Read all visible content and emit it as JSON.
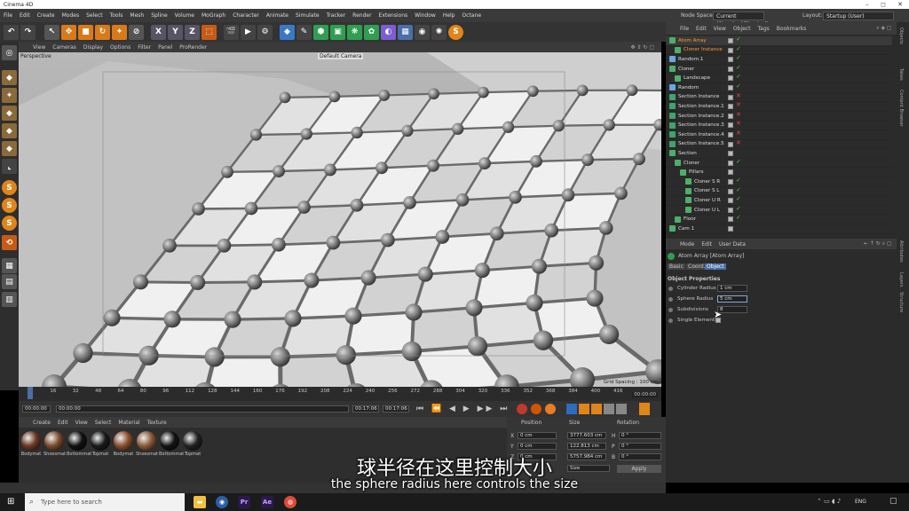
{
  "window": {
    "title": "Cinema 4D",
    "min": "–",
    "max": "◻",
    "close": "✕"
  },
  "menu": {
    "items": [
      "File",
      "Edit",
      "Create",
      "Modes",
      "Select",
      "Tools",
      "Mesh",
      "Spline",
      "Volume",
      "MoGraph",
      "Character",
      "Animate",
      "Simulate",
      "Tracker",
      "Render",
      "Extensions",
      "Window",
      "Help",
      "Octane"
    ],
    "node_space_label": "Node Space:",
    "node_space_value": "Current (Standard/Physical)",
    "layout_label": "Layout:",
    "layout_value": "Startup (User)"
  },
  "toolbar": {
    "x": "X",
    "y": "Y",
    "z": "Z"
  },
  "viewport": {
    "menu": [
      "View",
      "Cameras",
      "Display",
      "Options",
      "Filter",
      "Panel",
      "ProRender"
    ],
    "label": "Perspective",
    "camera": "Default Camera",
    "grid_spacing": "Grid Spacing : 100 cm"
  },
  "timeline": {
    "ticks": [
      "0",
      "16",
      "32",
      "48",
      "64",
      "80",
      "96",
      "112",
      "128",
      "144",
      "160",
      "176",
      "192",
      "208",
      "224",
      "240",
      "256",
      "272",
      "288",
      "304",
      "320",
      "336",
      "352",
      "368",
      "384",
      "400",
      "416"
    ],
    "current_frame": "00:00:00"
  },
  "transport": {
    "start": "00:00:00",
    "current": "00:00:00",
    "end1": "00:17:06",
    "end2": "00:17:06"
  },
  "materials": {
    "menu": [
      "Create",
      "Edit",
      "View",
      "Select",
      "Material",
      "Texture"
    ],
    "items": [
      {
        "name": "Bodymat",
        "color": "#6b3a24"
      },
      {
        "name": "Shoesmat",
        "color": "#7a4a2c"
      },
      {
        "name": "Bottommat",
        "color": "#111111"
      },
      {
        "name": "Topmat",
        "color": "#1a1a1a"
      },
      {
        "name": "Bodymat",
        "color": "#8a4e30"
      },
      {
        "name": "Shoesmat",
        "color": "#8a5a38"
      },
      {
        "name": "Bottommat",
        "color": "#141414"
      },
      {
        "name": "Topmat",
        "color": "#222222"
      }
    ]
  },
  "coords": {
    "headers": [
      "Position",
      "Size",
      "Rotation"
    ],
    "rows": [
      {
        "axis": "X",
        "pos": "0 cm",
        "size": "3777.603 cm",
        "rot_label": "H",
        "rot": "0 °"
      },
      {
        "axis": "Y",
        "pos": "0 cm",
        "size": "122.813 cm",
        "rot_label": "P",
        "rot": "0 °"
      },
      {
        "axis": "Z",
        "pos": "0 cm",
        "size": "5757.984 cm",
        "rot_label": "B",
        "rot": "0 °"
      }
    ],
    "mode": "Size",
    "apply": "Apply"
  },
  "objects": {
    "menu": [
      "File",
      "Edit",
      "View",
      "Object",
      "Tags",
      "Bookmarks"
    ],
    "rows": [
      {
        "name": "Atom Array",
        "indent": 0,
        "color": "#ff9a2e",
        "status": "g"
      },
      {
        "name": "Cloner Instance",
        "indent": 1,
        "color": "#ff9a2e",
        "status": "g"
      },
      {
        "name": "Random.1",
        "indent": 0,
        "color": "#dddddd",
        "status": "g"
      },
      {
        "name": "Cloner",
        "indent": 0,
        "color": "#dddddd",
        "status": "g"
      },
      {
        "name": "Landscape",
        "indent": 1,
        "color": "#dddddd",
        "status": "g"
      },
      {
        "name": "Random",
        "indent": 0,
        "color": "#dddddd",
        "status": "g"
      },
      {
        "name": "Section Instance",
        "indent": 0,
        "color": "#dddddd",
        "status": "r"
      },
      {
        "name": "Section Instance.1",
        "indent": 0,
        "color": "#dddddd",
        "status": "r"
      },
      {
        "name": "Section Instance.2",
        "indent": 0,
        "color": "#dddddd",
        "status": "r"
      },
      {
        "name": "Section Instance.3",
        "indent": 0,
        "color": "#dddddd",
        "status": "r"
      },
      {
        "name": "Section Instance.4",
        "indent": 0,
        "color": "#dddddd",
        "status": "r"
      },
      {
        "name": "Section Instance.5",
        "indent": 0,
        "color": "#dddddd",
        "status": "r"
      },
      {
        "name": "Section",
        "indent": 0,
        "color": "#dddddd",
        "status": "n"
      },
      {
        "name": "Cloner",
        "indent": 1,
        "color": "#dddddd",
        "status": "g"
      },
      {
        "name": "Pillars",
        "indent": 2,
        "color": "#dddddd",
        "status": "n"
      },
      {
        "name": "Cloner S R",
        "indent": 3,
        "color": "#dddddd",
        "status": "g"
      },
      {
        "name": "Cloner S L",
        "indent": 3,
        "color": "#dddddd",
        "status": "g"
      },
      {
        "name": "Cloner U R",
        "indent": 3,
        "color": "#dddddd",
        "status": "g"
      },
      {
        "name": "Cloner U L",
        "indent": 3,
        "color": "#dddddd",
        "status": "g"
      },
      {
        "name": "Floor",
        "indent": 1,
        "color": "#dddddd",
        "status": "g"
      },
      {
        "name": "Cam 1",
        "indent": 0,
        "color": "#dddddd",
        "status": "n"
      }
    ]
  },
  "attributes": {
    "menu": [
      "Mode",
      "Edit",
      "User Data"
    ],
    "object_name": "Atom Array [Atom Array]",
    "tabs": [
      "Basic",
      "Coord.",
      "Object"
    ],
    "section": "Object Properties",
    "props": [
      {
        "label": "Cylinder Radius",
        "value": "1 cm"
      },
      {
        "label": "Sphere Radius",
        "value": "5 cm"
      },
      {
        "label": "Subdivisions",
        "value": "8"
      },
      {
        "label": "Single Elements",
        "value": ""
      }
    ]
  },
  "sidetabs": [
    "Objects",
    "Takes",
    "Content Browser",
    "Attributes",
    "Layers",
    "Structure"
  ],
  "subtitles": {
    "cn": "球半径在这里控制大小",
    "en": "the sphere radius here controls the size"
  },
  "taskbar": {
    "search_placeholder": "Type here to search",
    "lang": "ENG"
  }
}
